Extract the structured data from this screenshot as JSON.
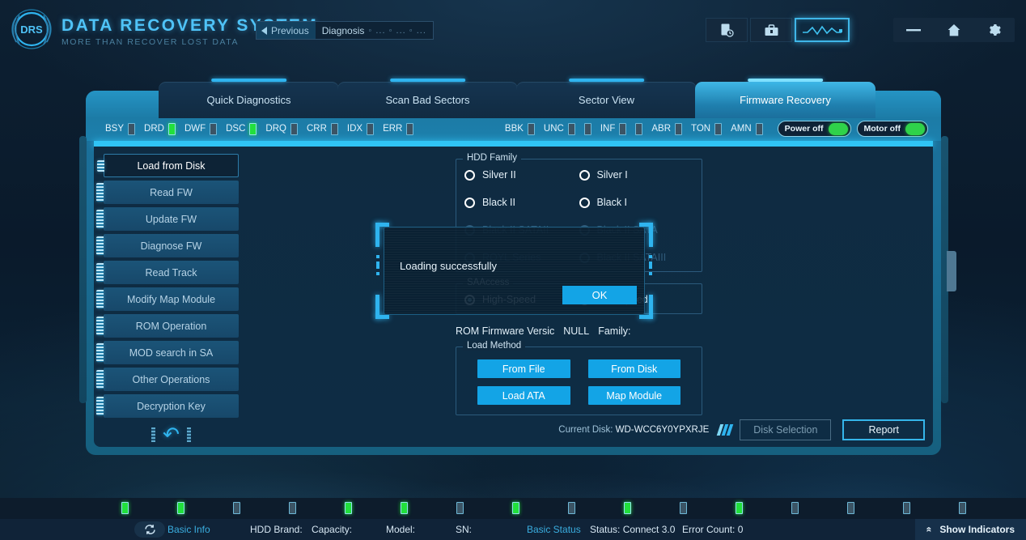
{
  "app": {
    "brand_main": "DATA RECOVERY SYSTEM",
    "brand_sub": "MORE THAN RECOVER LOST DATA",
    "logo_text": "DRS"
  },
  "titlebar": {
    "previous_label": "Previous",
    "current_label": "Diagnosis",
    "crumb_dots": "◦ ...  ◦ ...  ◦ ...",
    "tools": [
      {
        "name": "report-log-icon",
        "glyph": "὜8"
      },
      {
        "name": "toolbox-icon",
        "glyph": "ᾟ0"
      },
      {
        "name": "waveform-icon",
        "glyph": "wave"
      }
    ],
    "window": [
      {
        "name": "minimize-button",
        "glyph": "—"
      },
      {
        "name": "home-button",
        "glyph": "⌂"
      },
      {
        "name": "settings-button",
        "glyph": "⚙"
      }
    ]
  },
  "tabs": [
    {
      "label": "Quick Diagnostics",
      "active": false
    },
    {
      "label": "Scan Bad Sectors",
      "active": false
    },
    {
      "label": "Sector View",
      "active": false
    },
    {
      "label": "Firmware Recovery",
      "active": true
    }
  ],
  "status_leds_left": [
    {
      "label": "BSY",
      "on": false
    },
    {
      "label": "DRD",
      "on": true
    },
    {
      "label": "DWF",
      "on": false
    },
    {
      "label": "DSC",
      "on": true
    },
    {
      "label": "DRQ",
      "on": false
    },
    {
      "label": "CRR",
      "on": false
    },
    {
      "label": "IDX",
      "on": false
    },
    {
      "label": "ERR",
      "on": false
    }
  ],
  "status_leds_right": [
    {
      "label": "BBK",
      "on": false
    },
    {
      "label": "UNC",
      "on": false
    },
    {
      "label": "",
      "on": false
    },
    {
      "label": "INF",
      "on": false
    },
    {
      "label": "",
      "on": false
    },
    {
      "label": "ABR",
      "on": false
    },
    {
      "label": "TON",
      "on": false
    },
    {
      "label": "AMN",
      "on": false
    }
  ],
  "toggles": [
    {
      "name": "power-toggle",
      "label": "Power off"
    },
    {
      "name": "motor-toggle",
      "label": "Motor off"
    }
  ],
  "sidebar": {
    "items": [
      {
        "label": "Load from Disk",
        "active": true
      },
      {
        "label": "Read FW",
        "active": false
      },
      {
        "label": "Update FW",
        "active": false
      },
      {
        "label": "Diagnose FW",
        "active": false
      },
      {
        "label": "Read Track",
        "active": false
      },
      {
        "label": "Modify Map Module",
        "active": false
      },
      {
        "label": "ROM Operation",
        "active": false
      },
      {
        "label": "MOD search in SA",
        "active": false
      },
      {
        "label": "Other Operations",
        "active": false
      },
      {
        "label": "Decryption Key",
        "active": false
      }
    ],
    "back_icon": "↶"
  },
  "options": {
    "hdd_family_legend": "HDD Family",
    "families": [
      {
        "label": "Silver II",
        "state": "normal"
      },
      {
        "label": "Silver I",
        "state": "normal"
      },
      {
        "label": "Black II",
        "state": "normal"
      },
      {
        "label": "Black I",
        "state": "normal"
      },
      {
        "label": "Black II SATAII",
        "state": "dim"
      },
      {
        "label": "Black II SATA",
        "state": "dim"
      },
      {
        "label": "ROYL Series",
        "state": "dim"
      },
      {
        "label": "Black II SATAIII",
        "state": "dim"
      }
    ],
    "saaccess_legend": "SAAccess",
    "saaccess": [
      {
        "label": "High-Speed",
        "state": "sel"
      },
      {
        "label": "Low-Speed",
        "state": "normal"
      }
    ],
    "rom_version_label": "ROM Firmware Versic",
    "rom_version_value": "NULL",
    "family_label": "Family:",
    "load_method_legend": "Load Method",
    "load_buttons": [
      {
        "label": "From File"
      },
      {
        "label": "From Disk"
      },
      {
        "label": "Load ATA"
      },
      {
        "label": "Map Module"
      }
    ]
  },
  "modal": {
    "message": "Loading successfully",
    "ok_label": "OK"
  },
  "diskbar": {
    "current_disk_label": "Current Disk:",
    "current_disk_value": "WD-WCC6Y0YPXRJE",
    "disk_selection_label": "Disk Selection",
    "report_label": "Report"
  },
  "bottom": {
    "indicator_leds": [
      true,
      true,
      false,
      false,
      true,
      true,
      false,
      true,
      false,
      true,
      false,
      true,
      false,
      false,
      false,
      false
    ],
    "info_items": [
      {
        "label": "Basic Info",
        "accent": true
      },
      {
        "label": "HDD Brand:",
        "accent": false
      },
      {
        "label": "Capacity:",
        "accent": false
      },
      {
        "label": "Model:",
        "accent": false
      },
      {
        "label": "SN:",
        "accent": false
      },
      {
        "label": "Basic Status",
        "accent": true
      },
      {
        "label": "Status: Connect 3.0",
        "accent": false
      },
      {
        "label": "Error Count: 0",
        "accent": false
      }
    ],
    "refresh_icon": "↻",
    "show_indicators_label": "Show Indicators",
    "chevron_icon": "«"
  },
  "colors": {
    "accent": "#2fb4ef",
    "button_blue": "#13a4e6",
    "led_on": "#22e03c",
    "panel": "#0f2b41"
  }
}
